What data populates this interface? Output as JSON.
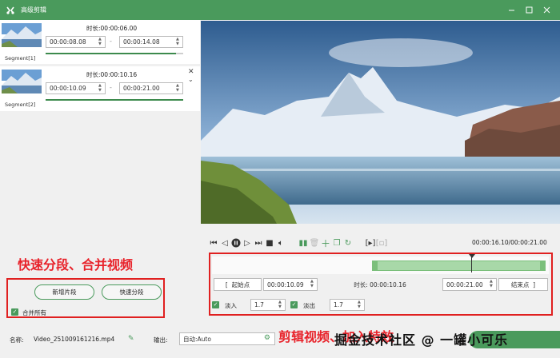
{
  "window": {
    "title": "高级剪辑"
  },
  "segments": [
    {
      "label": "Segment[1]",
      "duration_label": "时长:",
      "duration": "00:00:06.00",
      "start": "00:00:08.08",
      "end": "00:00:14.08",
      "separator": "-",
      "progress": 0.95
    },
    {
      "label": "Segment[2]",
      "duration_label": "时长:",
      "duration": "00:00:10.16",
      "start": "00:00:10.09",
      "end": "00:00:21.00",
      "separator": "-",
      "progress": 1.0
    }
  ],
  "left_actions": {
    "add_segment": "新增片段",
    "quick_split": "快速分段",
    "merge_all": "合并所有",
    "merge_checked": true
  },
  "annotation_left": "快速分段、合并视频",
  "annotation_right": "剪辑视频、加入特效",
  "watermark": "掘金技术社区 @ 一罐小可乐",
  "player": {
    "time": "00:00:16.10/00:00:21.00"
  },
  "trim": {
    "start_btn": "起始点",
    "start_time": "00:00:10.09",
    "duration_label": "时长:",
    "duration": "00:00:10.16",
    "end_time": "00:00:21.00",
    "end_btn": "结束点",
    "fade_in_label": "淡入",
    "fade_in": "1.7",
    "fade_in_checked": true,
    "fade_out_label": "淡出",
    "fade_out": "1.7",
    "fade_out_checked": true,
    "playhead_fraction": 0.769,
    "selection_start_fraction": 0.475
  },
  "output": {
    "name_label": "名称:",
    "name": "Video_251009161216.mp4",
    "out_label": "输出:",
    "out_value": "自动:Auto"
  },
  "colors": {
    "accent": "#4a9a5c",
    "annotation": "#e8222a"
  }
}
